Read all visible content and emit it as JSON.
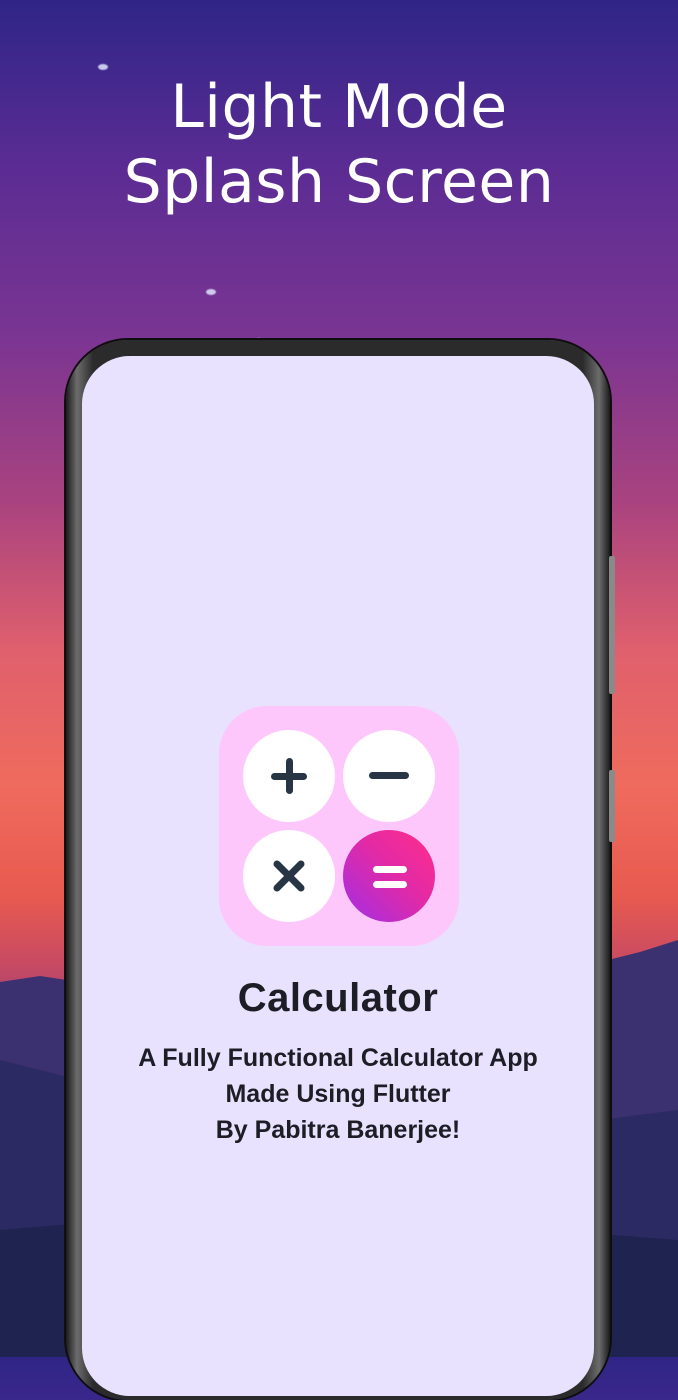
{
  "headline": {
    "line1": "Light Mode",
    "line2": "Splash Screen"
  },
  "app": {
    "name": "Calculator",
    "tagline_lines": [
      "A Fully Functional Calculator App",
      "Made Using Flutter",
      "By Pabitra Banerjee!"
    ],
    "icon_keys": [
      "plus-icon",
      "minus-icon",
      "multiply-icon",
      "equals-icon"
    ]
  },
  "colors": {
    "screen_bg": "#e9e2fe",
    "icon_bg": "#fdc7fb",
    "equals_gradient_start": "#ff2d8a",
    "equals_gradient_end": "#a12ee6",
    "text": "#1d1d25"
  }
}
